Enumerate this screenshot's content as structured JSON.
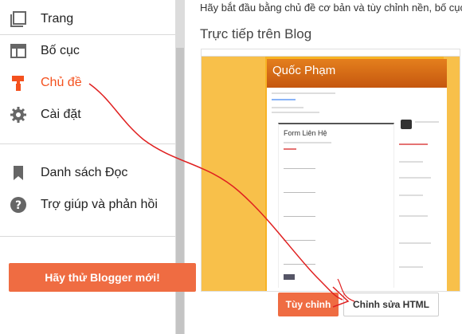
{
  "sidebar": {
    "items": [
      {
        "label": "Trang",
        "icon": "pages-icon"
      },
      {
        "label": "Bố cục",
        "icon": "layout-icon"
      },
      {
        "label": "Chủ đề",
        "icon": "theme-roller-icon",
        "active": true
      },
      {
        "label": "Cài đặt",
        "icon": "gear-icon"
      },
      {
        "label": "Danh sách Đọc",
        "icon": "bookmark-icon"
      },
      {
        "label": "Trợ giúp và phản hồi",
        "icon": "help-icon"
      }
    ],
    "try_button": "Hãy thử Blogger mới!"
  },
  "main": {
    "intro": "Hãy bắt đầu bằng chủ đề cơ bản và tùy chỉnh nền, bố cục",
    "section_title": "Trực tiếp trên Blog",
    "preview": {
      "blog_title": "Quốc Phạm",
      "form_title": "Form Liên Hệ"
    },
    "customize_button": "Tùy chỉnh",
    "edit_html_button": "Chỉnh sửa HTML"
  },
  "colors": {
    "accent": "#f4511e",
    "button_orange": "#ef6c42",
    "preview_bg": "#f7b324",
    "annotation_red": "#e02020"
  }
}
